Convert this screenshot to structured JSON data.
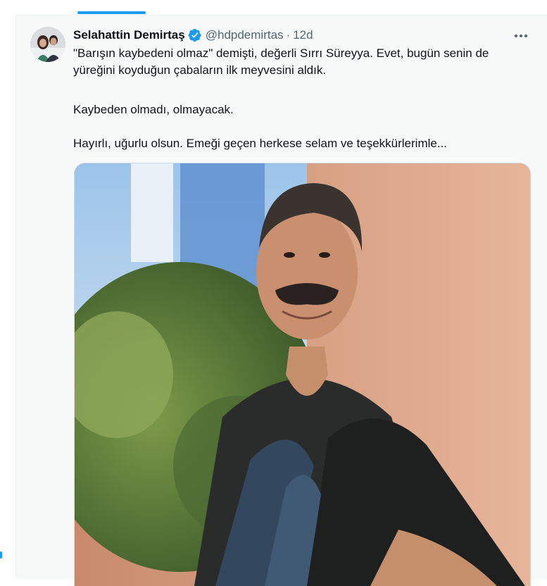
{
  "tweet": {
    "author_name": "Selahattin Demirtaş",
    "handle": "@hdpdemirtas",
    "separator": "·",
    "time": "12d",
    "paragraphs": [
      "\"Barışın kaybedeni olmaz\" demişti, değerli Sırrı Süreyya. Evet, bugün senin de yüreğini koyduğun çabaların ilk meyvesini aldık.",
      "Kaybeden olmadı, olmayacak.",
      "Hayırlı, uğurlu olsun. Emeği geçen herkese selam ve teşekkürlerimle..."
    ]
  },
  "icons": {
    "verified": "verified-badge-icon",
    "more": "more-options-icon"
  },
  "colors": {
    "accent": "#1d9bf0",
    "background": "#f7f9f9",
    "secondary_text": "#536471"
  }
}
